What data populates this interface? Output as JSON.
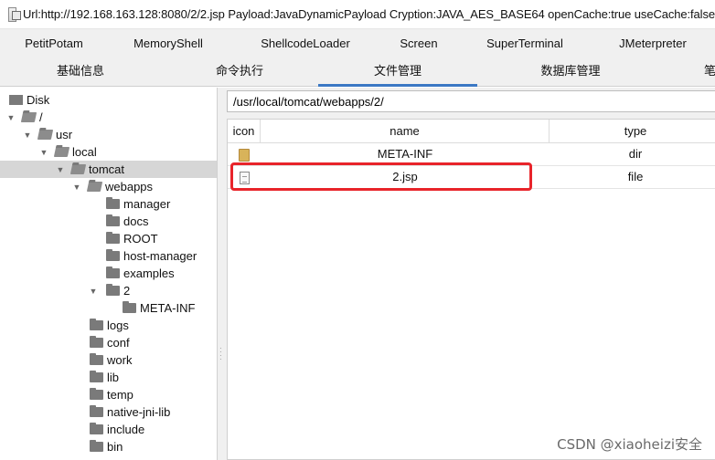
{
  "window": {
    "title": "Url:http://192.168.163.128:8080/2/2.jsp Payload:JavaDynamicPayload Cryption:JAVA_AES_BASE64 openCache:true useCache:false"
  },
  "plugin_tabs": [
    "PetitPotam",
    "MemoryShell",
    "ShellcodeLoader",
    "Screen",
    "SuperTerminal",
    "JMeterpreter"
  ],
  "main_tabs": [
    {
      "label": "基础信息"
    },
    {
      "label": "命令执行"
    },
    {
      "label": "文件管理",
      "active": true
    },
    {
      "label": "数据库管理"
    },
    {
      "label": "笔"
    }
  ],
  "tree": [
    {
      "label": "Disk",
      "kind": "drive"
    },
    {
      "label": "/",
      "kind": "folder-open",
      "expanded": true
    },
    {
      "label": "usr",
      "kind": "folder-open",
      "expanded": true
    },
    {
      "label": "local",
      "kind": "folder-open",
      "expanded": true
    },
    {
      "label": "tomcat",
      "kind": "folder-open",
      "expanded": true,
      "selected": true
    },
    {
      "label": "webapps",
      "kind": "folder-open",
      "expanded": true
    },
    {
      "label": "manager",
      "kind": "folder"
    },
    {
      "label": "docs",
      "kind": "folder"
    },
    {
      "label": "ROOT",
      "kind": "folder"
    },
    {
      "label": "host-manager",
      "kind": "folder"
    },
    {
      "label": "examples",
      "kind": "folder"
    },
    {
      "label": "2",
      "kind": "folder",
      "expanded": true
    },
    {
      "label": "META-INF",
      "kind": "folder"
    },
    {
      "label": "logs",
      "kind": "folder"
    },
    {
      "label": "conf",
      "kind": "folder"
    },
    {
      "label": "work",
      "kind": "folder"
    },
    {
      "label": "lib",
      "kind": "folder"
    },
    {
      "label": "temp",
      "kind": "folder"
    },
    {
      "label": "native-jni-lib",
      "kind": "folder"
    },
    {
      "label": "include",
      "kind": "folder"
    },
    {
      "label": "bin",
      "kind": "folder"
    }
  ],
  "file_manager": {
    "path": "/usr/local/tomcat/webapps/2/",
    "columns": [
      "icon",
      "name",
      "type"
    ],
    "rows": [
      {
        "icon": "dir-icon",
        "name": "META-INF",
        "type": "dir"
      },
      {
        "icon": "file-icon",
        "name": "2.jsp",
        "type": "file"
      }
    ]
  },
  "colors": {
    "highlight": "#e8242a",
    "active_tab_underline": "#3b78c4"
  },
  "watermark": "CSDN @xiaoheizi安全"
}
